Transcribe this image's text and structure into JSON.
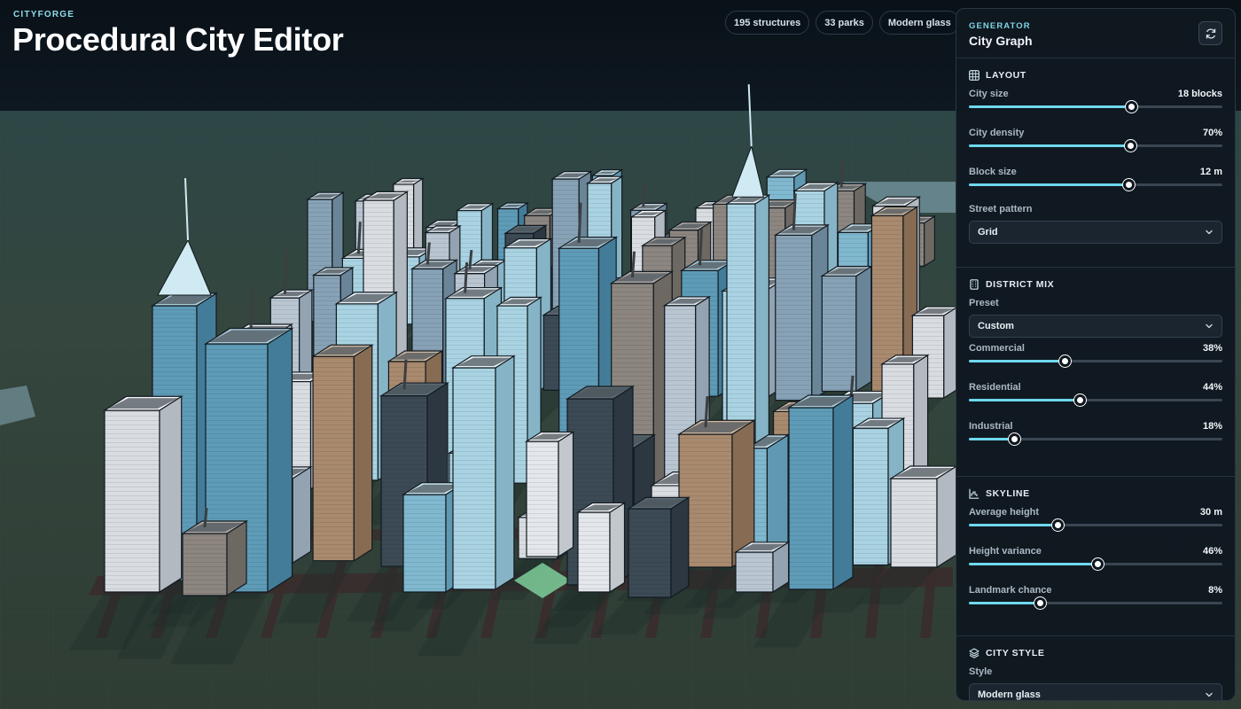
{
  "app": {
    "brand": "CITYFORGE",
    "title": "Procedural City Editor"
  },
  "stats": [
    {
      "label": "195 structures"
    },
    {
      "label": "33 parks"
    },
    {
      "label": "Modern glass"
    }
  ],
  "panel": {
    "eyebrow": "GENERATOR",
    "title": "City Graph",
    "refresh_icon": "refresh-icon",
    "sections": {
      "layout": {
        "title": "LAYOUT",
        "icon": "grid-icon",
        "controls": [
          {
            "label": "City size",
            "value": "18 blocks",
            "fraction": 0.64
          },
          {
            "label": "City density",
            "value": "70%",
            "fraction": 0.637
          },
          {
            "label": "Block size",
            "value": "12 m",
            "fraction": 0.63
          }
        ],
        "street_pattern_label": "Street pattern",
        "street_pattern_value": "Grid"
      },
      "district_mix": {
        "title": "DISTRICT MIX",
        "icon": "building-icon",
        "preset_label": "Preset",
        "preset_value": "Custom",
        "controls": [
          {
            "label": "Commercial",
            "value": "38%",
            "fraction": 0.38
          },
          {
            "label": "Residential",
            "value": "44%",
            "fraction": 0.44
          },
          {
            "label": "Industrial",
            "value": "18%",
            "fraction": 0.18
          }
        ]
      },
      "skyline": {
        "title": "SKYLINE",
        "icon": "skyline-chart-icon",
        "controls": [
          {
            "label": "Average height",
            "value": "30 m",
            "fraction": 0.35
          },
          {
            "label": "Height variance",
            "value": "46%",
            "fraction": 0.51
          },
          {
            "label": "Landmark chance",
            "value": "8%",
            "fraction": 0.28
          }
        ]
      },
      "city_style": {
        "title": "CITY STYLE",
        "icon": "layers-icon",
        "style_label": "Style",
        "style_value": "Modern glass",
        "swatches": [
          "#1c2a26",
          "#121a22",
          "#a9dbea",
          "#6fd8ee",
          "#2f5f78"
        ]
      }
    }
  },
  "colors": {
    "accent": "#6fd8ee",
    "ground": "#2c3a36",
    "sky": "#0b121a"
  }
}
